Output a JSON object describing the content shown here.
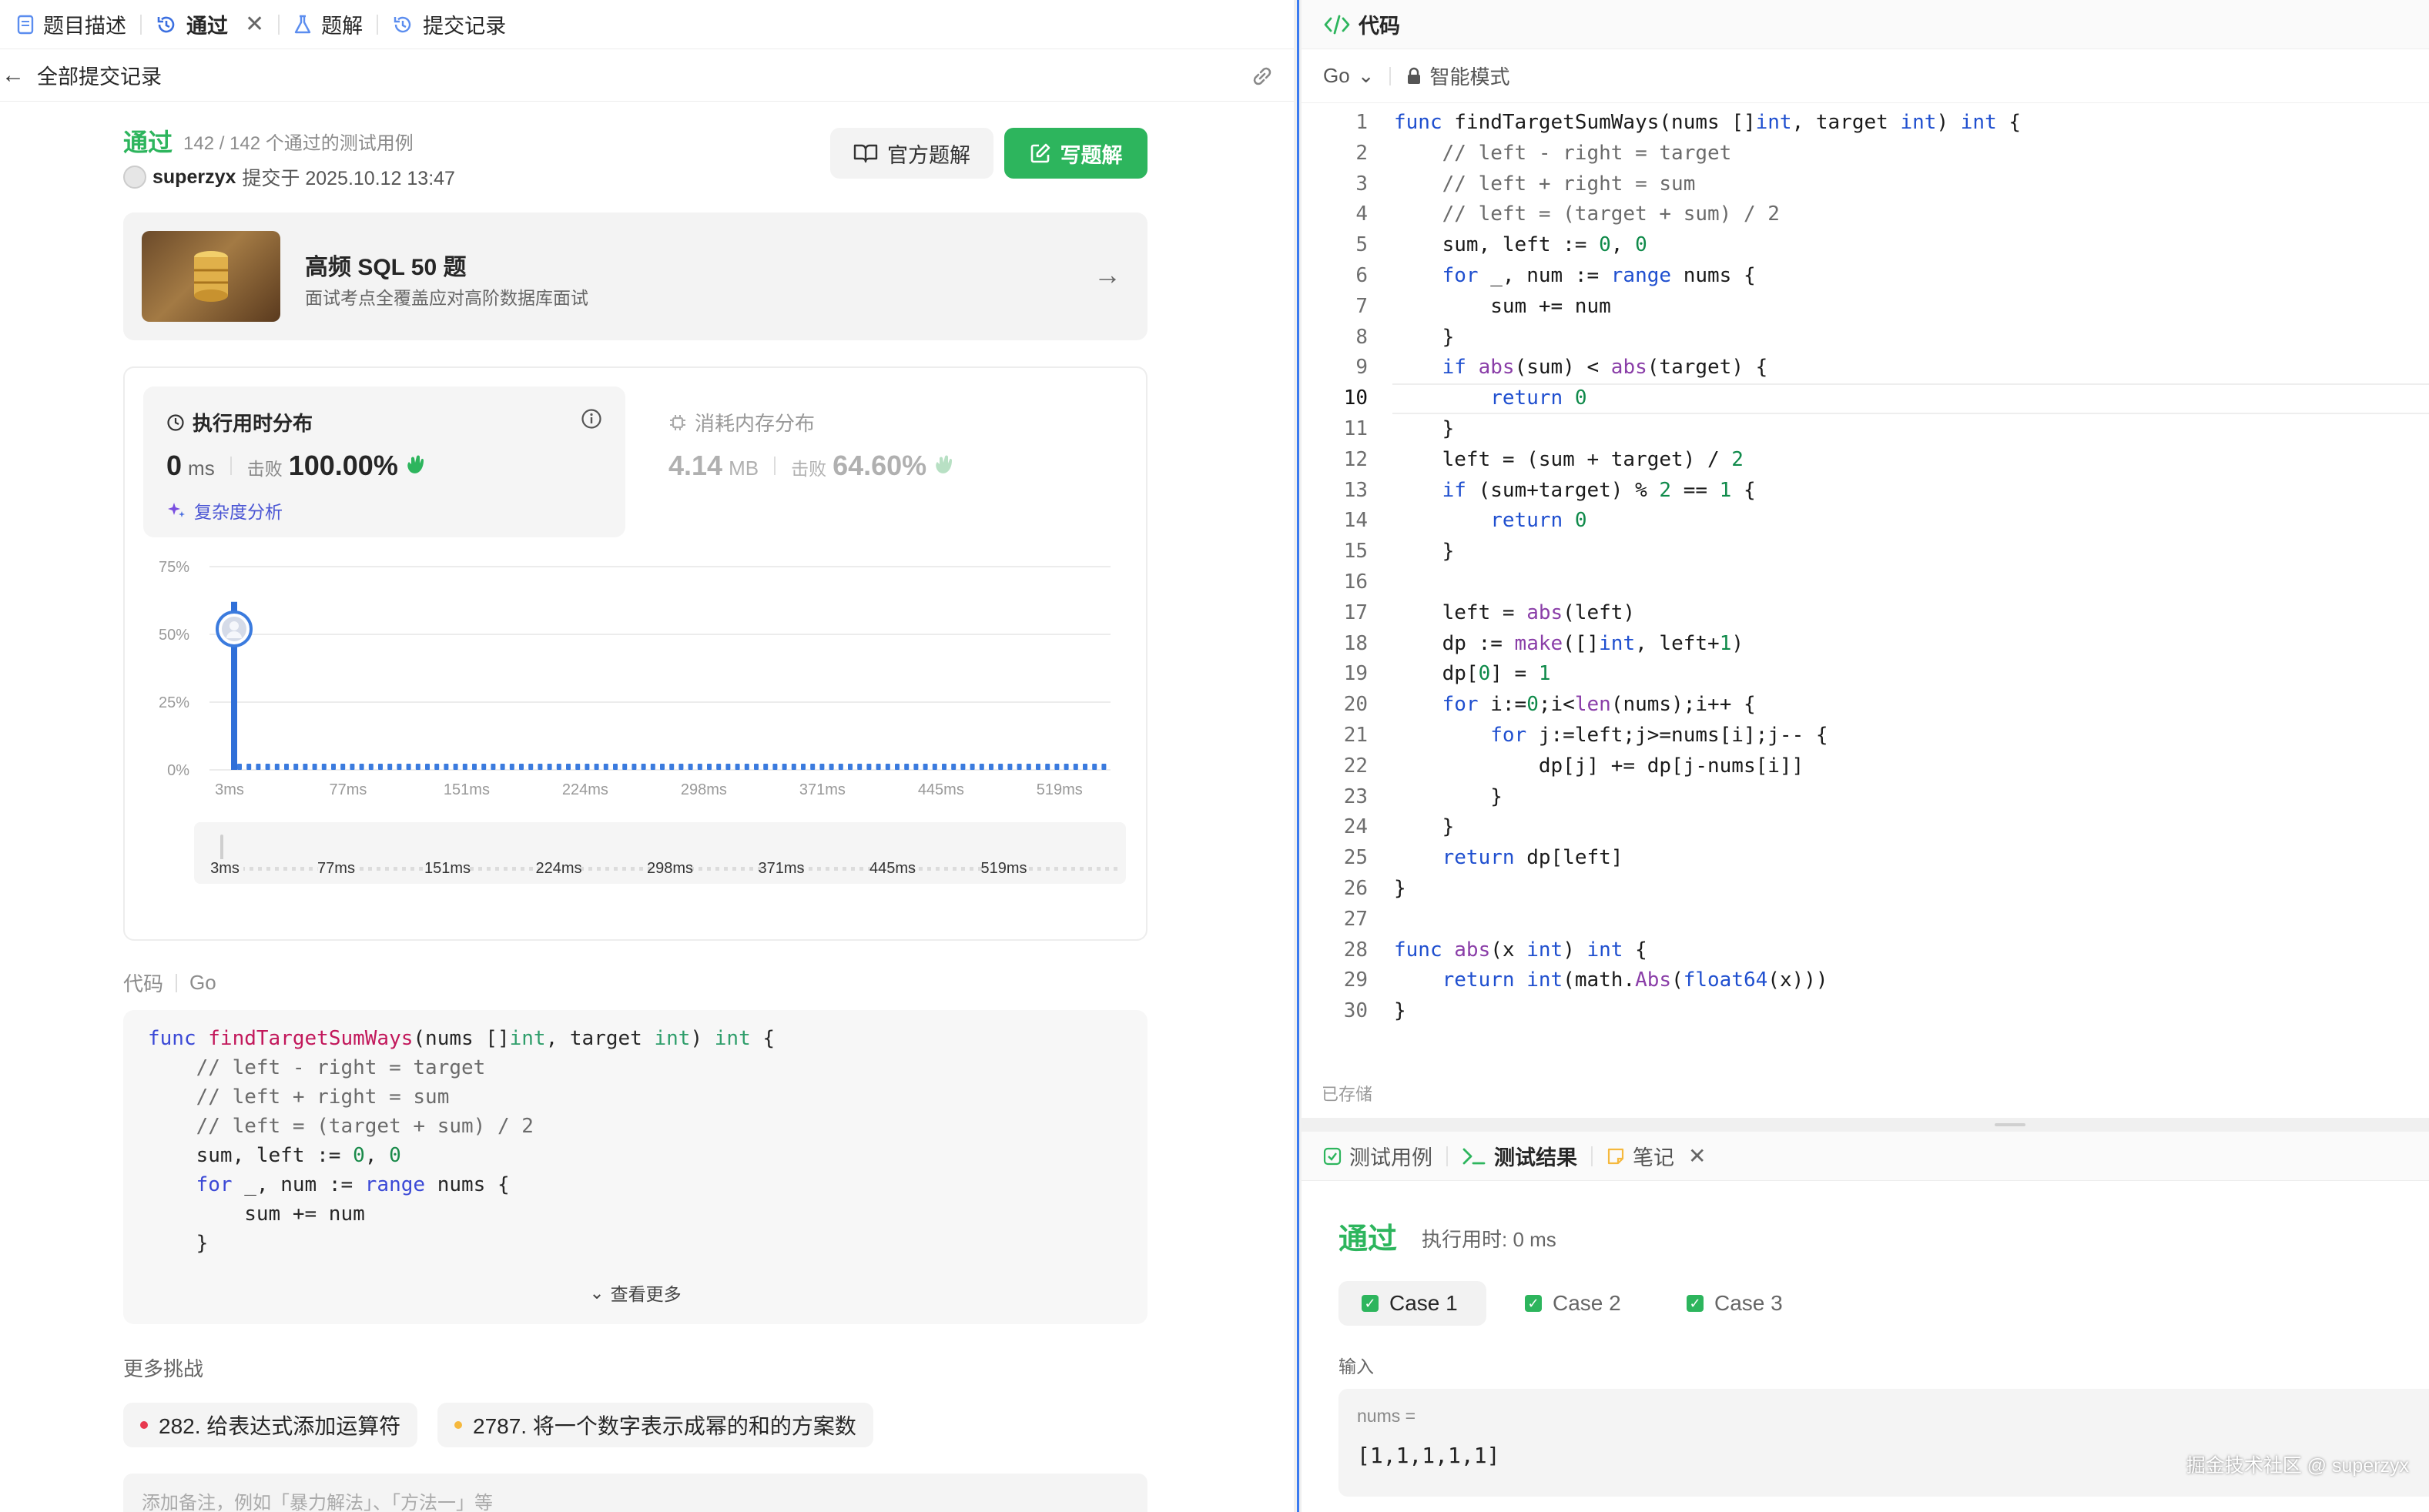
{
  "left_tabs": [
    {
      "icon": "document-icon",
      "label": "题目描述",
      "active": false
    },
    {
      "icon": "history-icon",
      "label": "通过",
      "active": true,
      "closable": true
    },
    {
      "icon": "flask-icon",
      "label": "题解",
      "active": false
    },
    {
      "icon": "clock-icon",
      "label": "提交记录",
      "active": false
    }
  ],
  "subheader": {
    "back_label": "全部提交记录"
  },
  "submission": {
    "status": "通过",
    "cases": "142 / 142 个通过的测试用例",
    "user": "superzyx",
    "submitted_at": "提交于 2025.10.12 13:47",
    "official_solution_label": "官方题解",
    "write_solution_label": "写题解"
  },
  "promo": {
    "title": "高频 SQL 50 题",
    "subtitle": "面试考点全覆盖应对高阶数据库面试"
  },
  "stats": {
    "runtime_title": "执行用时分布",
    "runtime_value": "0",
    "runtime_unit": "ms",
    "beats_label": "击败",
    "runtime_beats": "100.00%",
    "complexity_label": "复杂度分析",
    "memory_title": "消耗内存分布",
    "memory_value": "4.14",
    "memory_unit": "MB",
    "memory_beats": "64.60%"
  },
  "chart_data": {
    "type": "bar",
    "y_ticks": [
      "75%",
      "50%",
      "25%",
      "0%"
    ],
    "ylim": [
      0,
      75
    ],
    "x_ticks": [
      "3ms",
      "77ms",
      "151ms",
      "224ms",
      "298ms",
      "371ms",
      "445ms",
      "519ms"
    ],
    "bars": [
      {
        "x": "3ms",
        "value": 62
      }
    ],
    "marker": {
      "x": "3ms",
      "value": 52
    },
    "minimap_ticks": [
      "3ms",
      "77ms",
      "151ms",
      "224ms",
      "298ms",
      "371ms",
      "445ms",
      "519ms"
    ]
  },
  "code_section": {
    "label": "代码",
    "lang": "Go",
    "preview_lines": [
      "func findTargetSumWays(nums []int, target int) int {",
      "    // left - right = target",
      "    // left + right = sum",
      "    // left = (target + sum) / 2",
      "    sum, left := 0, 0",
      "    for _, num := range nums {",
      "        sum += num",
      "    }"
    ],
    "see_more_label": "查看更多"
  },
  "more": {
    "title": "更多挑战",
    "items": [
      {
        "label": "282. 给表达式添加运算符",
        "dot": "#e8384f"
      },
      {
        "label": "2787. 将一个数字表示成幂的和的方案数",
        "dot": "#f5b83d"
      }
    ],
    "note_placeholder": "添加备注，例如「暴力解法」、「方法一」等"
  },
  "editor": {
    "title": "代码",
    "lang": "Go",
    "mode": "智能模式",
    "saved": "已存储",
    "current_line": 10,
    "lines": [
      "func findTargetSumWays(nums []int, target int) int {",
      "    // left - right = target",
      "    // left + right = sum",
      "    // left = (target + sum) / 2",
      "    sum, left := 0, 0",
      "    for _, num := range nums {",
      "        sum += num",
      "    }",
      "    if abs(sum) < abs(target) {",
      "        return 0",
      "    }",
      "    left = (sum + target) / 2",
      "    if (sum+target) % 2 == 1 {",
      "        return 0",
      "    }",
      "",
      "    left = abs(left)",
      "    dp := make([]int, left+1)",
      "    dp[0] = 1",
      "    for i:=0;i<len(nums);i++ {",
      "        for j:=left;j>=nums[i];j-- {",
      "            dp[j] += dp[j-nums[i]]",
      "        }",
      "    }",
      "    return dp[left]",
      "}",
      "",
      "func abs(x int) int {",
      "    return int(math.Abs(float64(x)))",
      "}"
    ]
  },
  "console": {
    "tabs": [
      {
        "icon": "checkbox-icon",
        "label": "测试用例"
      },
      {
        "icon": "terminal-icon",
        "label": "测试结果"
      },
      {
        "icon": "note-icon",
        "label": "笔记"
      }
    ],
    "status": "通过",
    "runtime": "执行用时: 0 ms",
    "cases": [
      "Case 1",
      "Case 2",
      "Case 3"
    ],
    "input_label": "输入",
    "var_name": "nums =",
    "var_value": "[1,1,1,1,1]"
  },
  "watermark": "掘金技术社区 @ superzyx"
}
